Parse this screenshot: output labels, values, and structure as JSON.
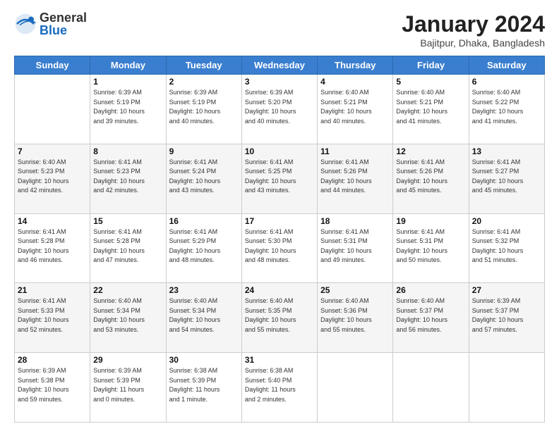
{
  "header": {
    "logo_general": "General",
    "logo_blue": "Blue",
    "month_year": "January 2024",
    "location": "Bajitpur, Dhaka, Bangladesh"
  },
  "weekdays": [
    "Sunday",
    "Monday",
    "Tuesday",
    "Wednesday",
    "Thursday",
    "Friday",
    "Saturday"
  ],
  "weeks": [
    [
      {
        "day": "",
        "info": ""
      },
      {
        "day": "1",
        "info": "Sunrise: 6:39 AM\nSunset: 5:19 PM\nDaylight: 10 hours\nand 39 minutes."
      },
      {
        "day": "2",
        "info": "Sunrise: 6:39 AM\nSunset: 5:19 PM\nDaylight: 10 hours\nand 40 minutes."
      },
      {
        "day": "3",
        "info": "Sunrise: 6:39 AM\nSunset: 5:20 PM\nDaylight: 10 hours\nand 40 minutes."
      },
      {
        "day": "4",
        "info": "Sunrise: 6:40 AM\nSunset: 5:21 PM\nDaylight: 10 hours\nand 40 minutes."
      },
      {
        "day": "5",
        "info": "Sunrise: 6:40 AM\nSunset: 5:21 PM\nDaylight: 10 hours\nand 41 minutes."
      },
      {
        "day": "6",
        "info": "Sunrise: 6:40 AM\nSunset: 5:22 PM\nDaylight: 10 hours\nand 41 minutes."
      }
    ],
    [
      {
        "day": "7",
        "info": "Sunrise: 6:40 AM\nSunset: 5:23 PM\nDaylight: 10 hours\nand 42 minutes."
      },
      {
        "day": "8",
        "info": "Sunrise: 6:41 AM\nSunset: 5:23 PM\nDaylight: 10 hours\nand 42 minutes."
      },
      {
        "day": "9",
        "info": "Sunrise: 6:41 AM\nSunset: 5:24 PM\nDaylight: 10 hours\nand 43 minutes."
      },
      {
        "day": "10",
        "info": "Sunrise: 6:41 AM\nSunset: 5:25 PM\nDaylight: 10 hours\nand 43 minutes."
      },
      {
        "day": "11",
        "info": "Sunrise: 6:41 AM\nSunset: 5:26 PM\nDaylight: 10 hours\nand 44 minutes."
      },
      {
        "day": "12",
        "info": "Sunrise: 6:41 AM\nSunset: 5:26 PM\nDaylight: 10 hours\nand 45 minutes."
      },
      {
        "day": "13",
        "info": "Sunrise: 6:41 AM\nSunset: 5:27 PM\nDaylight: 10 hours\nand 45 minutes."
      }
    ],
    [
      {
        "day": "14",
        "info": "Sunrise: 6:41 AM\nSunset: 5:28 PM\nDaylight: 10 hours\nand 46 minutes."
      },
      {
        "day": "15",
        "info": "Sunrise: 6:41 AM\nSunset: 5:28 PM\nDaylight: 10 hours\nand 47 minutes."
      },
      {
        "day": "16",
        "info": "Sunrise: 6:41 AM\nSunset: 5:29 PM\nDaylight: 10 hours\nand 48 minutes."
      },
      {
        "day": "17",
        "info": "Sunrise: 6:41 AM\nSunset: 5:30 PM\nDaylight: 10 hours\nand 48 minutes."
      },
      {
        "day": "18",
        "info": "Sunrise: 6:41 AM\nSunset: 5:31 PM\nDaylight: 10 hours\nand 49 minutes."
      },
      {
        "day": "19",
        "info": "Sunrise: 6:41 AM\nSunset: 5:31 PM\nDaylight: 10 hours\nand 50 minutes."
      },
      {
        "day": "20",
        "info": "Sunrise: 6:41 AM\nSunset: 5:32 PM\nDaylight: 10 hours\nand 51 minutes."
      }
    ],
    [
      {
        "day": "21",
        "info": "Sunrise: 6:41 AM\nSunset: 5:33 PM\nDaylight: 10 hours\nand 52 minutes."
      },
      {
        "day": "22",
        "info": "Sunrise: 6:40 AM\nSunset: 5:34 PM\nDaylight: 10 hours\nand 53 minutes."
      },
      {
        "day": "23",
        "info": "Sunrise: 6:40 AM\nSunset: 5:34 PM\nDaylight: 10 hours\nand 54 minutes."
      },
      {
        "day": "24",
        "info": "Sunrise: 6:40 AM\nSunset: 5:35 PM\nDaylight: 10 hours\nand 55 minutes."
      },
      {
        "day": "25",
        "info": "Sunrise: 6:40 AM\nSunset: 5:36 PM\nDaylight: 10 hours\nand 55 minutes."
      },
      {
        "day": "26",
        "info": "Sunrise: 6:40 AM\nSunset: 5:37 PM\nDaylight: 10 hours\nand 56 minutes."
      },
      {
        "day": "27",
        "info": "Sunrise: 6:39 AM\nSunset: 5:37 PM\nDaylight: 10 hours\nand 57 minutes."
      }
    ],
    [
      {
        "day": "28",
        "info": "Sunrise: 6:39 AM\nSunset: 5:38 PM\nDaylight: 10 hours\nand 59 minutes."
      },
      {
        "day": "29",
        "info": "Sunrise: 6:39 AM\nSunset: 5:39 PM\nDaylight: 11 hours\nand 0 minutes."
      },
      {
        "day": "30",
        "info": "Sunrise: 6:38 AM\nSunset: 5:39 PM\nDaylight: 11 hours\nand 1 minute."
      },
      {
        "day": "31",
        "info": "Sunrise: 6:38 AM\nSunset: 5:40 PM\nDaylight: 11 hours\nand 2 minutes."
      },
      {
        "day": "",
        "info": ""
      },
      {
        "day": "",
        "info": ""
      },
      {
        "day": "",
        "info": ""
      }
    ]
  ]
}
